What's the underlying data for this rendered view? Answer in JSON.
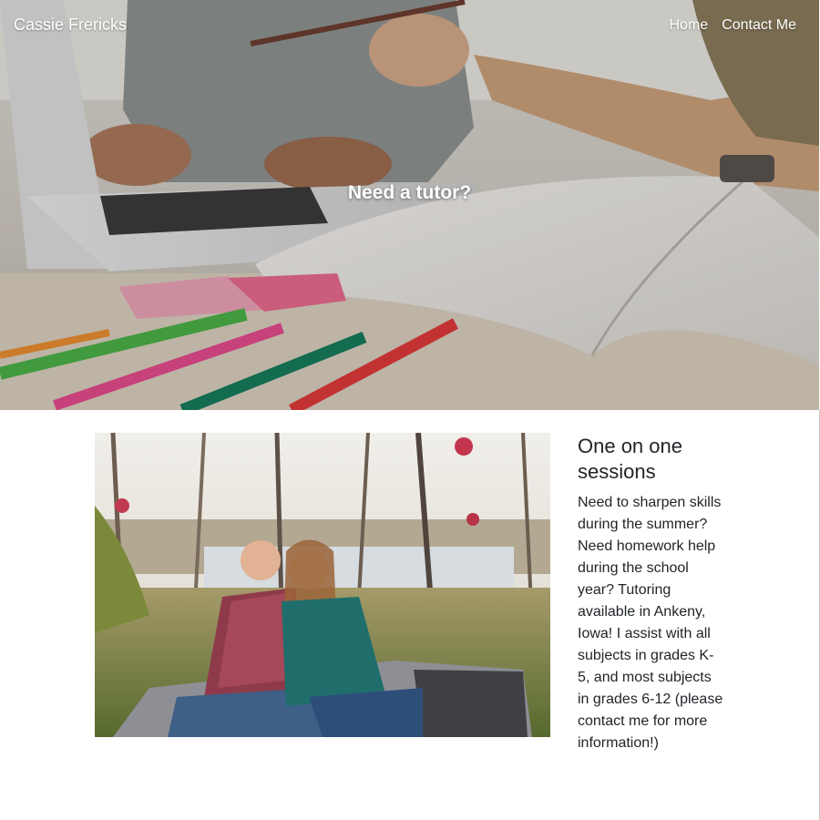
{
  "header": {
    "site_title": "Cassie Frericks",
    "nav": [
      {
        "label": "Home"
      },
      {
        "label": "Contact Me"
      }
    ]
  },
  "hero": {
    "headline": "Need a tutor?",
    "image_subject": "laptop-notebook-colored-pencils-photo"
  },
  "content": {
    "image_subject": "couple-outdoor-portrait-photo",
    "heading": "One on one sessions",
    "body": "Need to sharpen skills during the summer? Need homework help during the school year? Tutoring available in Ankeny, Iowa! I assist with all subjects in grades K-5, and most subjects in grades 6-12 (please contact me for more information!)"
  }
}
